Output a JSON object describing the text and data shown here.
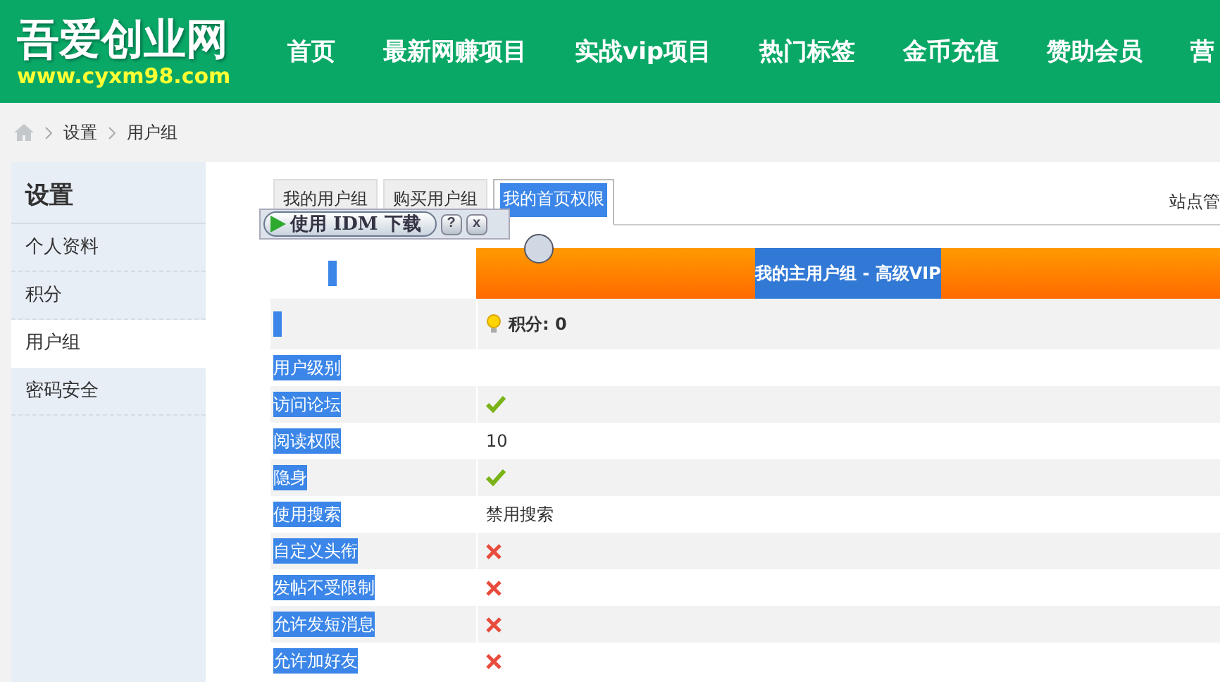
{
  "logo": {
    "title": "吾爱创业网",
    "url": "www.cyxm98.com"
  },
  "nav": [
    "首页",
    "最新网赚项目",
    "实战vip项目",
    "热门标签",
    "金币充值",
    "赞助会员",
    "营"
  ],
  "breadcrumb": [
    "设置",
    "用户组"
  ],
  "sidebar": {
    "title": "设置",
    "items": [
      {
        "label": "个人资料",
        "selected": false
      },
      {
        "label": "积分",
        "selected": false
      },
      {
        "label": "用户组",
        "selected": true
      },
      {
        "label": "密码安全",
        "selected": false
      }
    ]
  },
  "tabs": [
    {
      "label": "我的用户组",
      "selected": false,
      "highlighted": false
    },
    {
      "label": "购买用户组",
      "selected": false,
      "highlighted": false
    },
    {
      "label": "我的首页权限",
      "selected": true,
      "highlighted": true
    }
  ],
  "admin_link": "站点管",
  "idm": {
    "label": "使用 IDM 下载",
    "help": "?",
    "close": "x"
  },
  "group_header": {
    "text": "我的主用户组 - 高级VIP",
    "highlighted": true
  },
  "points": "积分: 0",
  "rows": [
    {
      "label": "用户级别",
      "kind": "empty",
      "highlighted": true
    },
    {
      "label": "访问论坛",
      "kind": "check",
      "highlighted": true
    },
    {
      "label": "阅读权限",
      "kind": "text",
      "value": "10",
      "highlighted": true
    },
    {
      "label": "隐身",
      "kind": "check",
      "highlighted": true
    },
    {
      "label": "使用搜索",
      "kind": "text",
      "value": "禁用搜索",
      "highlighted": true
    },
    {
      "label": "自定义头衔",
      "kind": "cross",
      "highlighted": true
    },
    {
      "label": "发帖不受限制",
      "kind": "cross",
      "highlighted": true
    },
    {
      "label": "允许发短消息",
      "kind": "cross",
      "highlighted": true
    },
    {
      "label": "允许加好友",
      "kind": "cross",
      "highlighted": true
    }
  ]
}
